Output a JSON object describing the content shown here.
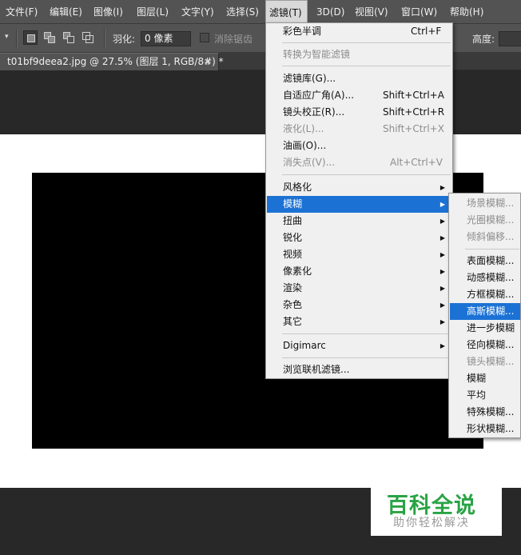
{
  "menubar": {
    "items": [
      "文件(F)",
      "编辑(E)",
      "图像(I)",
      "图层(L)",
      "文字(Y)",
      "选择(S)",
      "滤镜(T)",
      "3D(D)",
      "视图(V)",
      "窗口(W)",
      "帮助(H)"
    ],
    "active": "滤镜(T)"
  },
  "options_bar": {
    "feather_label": "羽化:",
    "feather_value": "0 像素",
    "antialias_label": "消除锯齿",
    "height_label": "高度:"
  },
  "document_tab": {
    "title": "t01bf9deea2.jpg @ 27.5% (图层 1, RGB/8#) *",
    "close": "×"
  },
  "filter_menu": {
    "last_filter": {
      "label": "彩色半调",
      "shortcut": "Ctrl+F"
    },
    "convert_smart": "转换为智能滤镜",
    "filter_gallery": "滤镜库(G)...",
    "adaptive_wide": {
      "label": "自适应广角(A)...",
      "shortcut": "Shift+Ctrl+A"
    },
    "lens_correction": {
      "label": "镜头校正(R)...",
      "shortcut": "Shift+Ctrl+R"
    },
    "liquify": {
      "label": "液化(L)...",
      "shortcut": "Shift+Ctrl+X"
    },
    "oil_paint": "油画(O)...",
    "vanishing_point": {
      "label": "消失点(V)...",
      "shortcut": "Alt+Ctrl+V"
    },
    "stylize": "风格化",
    "blur": "模糊",
    "distort": "扭曲",
    "sharpen": "锐化",
    "video": "视频",
    "pixelate": "像素化",
    "render": "渲染",
    "noise": "杂色",
    "other": "其它",
    "digimarc": "Digimarc",
    "browse_online": "浏览联机滤镜...",
    "arrow": "▶"
  },
  "blur_submenu": {
    "field_blur": "场景模糊...",
    "iris_blur": "光圈模糊...",
    "tilt_shift": "倾斜偏移...",
    "surface_blur": "表面模糊...",
    "motion_blur": "动感模糊...",
    "box_blur": "方框模糊...",
    "gaussian_blur": "高斯模糊...",
    "blur_more": "进一步模糊",
    "radial_blur": "径向模糊...",
    "lens_blur": "镜头模糊...",
    "blur": "模糊",
    "average": "平均",
    "smart_blur": "特殊模糊...",
    "shape_blur": "形状模糊..."
  },
  "watermark": {
    "main": "百科全说",
    "sub": "助你轻松解决"
  },
  "colors": {
    "highlight": "#1c72d4",
    "menu_bg": "#f0f0f0",
    "chrome": "#535353",
    "watermark_green": "#2aa345"
  }
}
